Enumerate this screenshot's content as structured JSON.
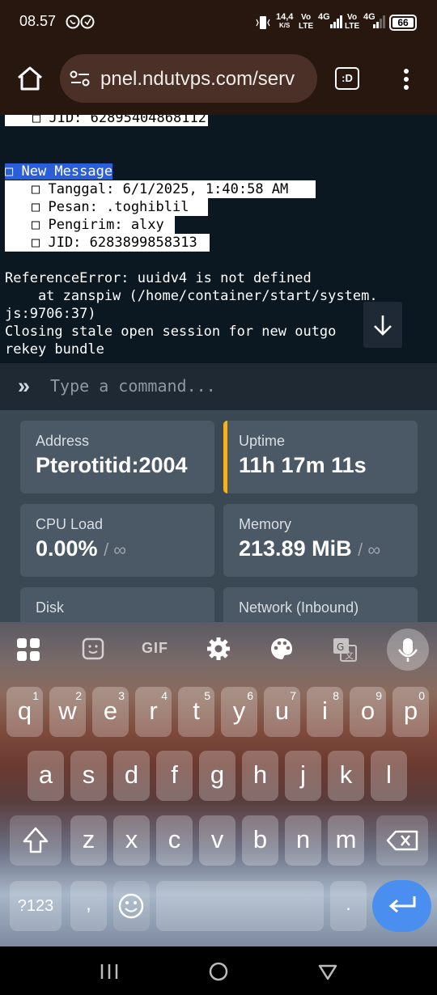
{
  "status_bar": {
    "time": "08.57",
    "net_speed_top": "14,4",
    "net_speed_unit": "K/S",
    "vo1": "Vo",
    "lte1": "LTE",
    "net1": "4G",
    "vo2": "Vo",
    "lte2": "LTE",
    "net2": "4G",
    "battery": "66"
  },
  "browser": {
    "url": "pnel.ndutvps.com/serv",
    "tab_icon_label": ":D"
  },
  "console": {
    "truncated_line": "□ JID: 62895404868112",
    "event_header": "□ New Message",
    "fields": [
      "□ Tanggal: 6/1/2025, 1:40:58 AM",
      "□ Pesan: .toghiblil",
      "□ Pengirim: alxy",
      "□ JID: 6283899858313"
    ],
    "error_lines": [
      "ReferenceError: uuidv4 is not defined",
      "    at zanspiw (/home/container/start/system.",
      "js:9706:37)",
      "Closing stale open session for new outgo    o",
      "rekey bundle"
    ]
  },
  "command": {
    "prompt": "»",
    "placeholder": "Type a command..."
  },
  "stats": [
    {
      "label": "Address",
      "value": "Pterotitid:2004",
      "suffix": ""
    },
    {
      "label": "Uptime",
      "value": "11h 17m 11s",
      "suffix": ""
    },
    {
      "label": "CPU Load",
      "value": "0.00%",
      "suffix": "/ ∞"
    },
    {
      "label": "Memory",
      "value": "213.89 MiB",
      "suffix": "/ ∞"
    },
    {
      "label": "Disk",
      "value": "",
      "suffix": ""
    },
    {
      "label": "Network (Inbound)",
      "value": "",
      "suffix": ""
    }
  ],
  "accent_color": "#f0b429",
  "keyboard": {
    "toolbar": {
      "gif": "GIF"
    },
    "row1": [
      {
        "k": "q",
        "n": "1"
      },
      {
        "k": "w",
        "n": "2"
      },
      {
        "k": "e",
        "n": "3"
      },
      {
        "k": "r",
        "n": "4"
      },
      {
        "k": "t",
        "n": "5"
      },
      {
        "k": "y",
        "n": "6"
      },
      {
        "k": "u",
        "n": "7"
      },
      {
        "k": "i",
        "n": "8"
      },
      {
        "k": "o",
        "n": "9"
      },
      {
        "k": "p",
        "n": "0"
      }
    ],
    "row2": [
      "a",
      "s",
      "d",
      "f",
      "g",
      "h",
      "j",
      "k",
      "l"
    ],
    "row3": [
      "z",
      "x",
      "c",
      "v",
      "b",
      "n",
      "m"
    ],
    "symbols_key": "?123",
    "comma_key": ",",
    "period_key": "."
  },
  "nav": {
    "recents": "☰",
    "home": "○",
    "back": "▽"
  }
}
